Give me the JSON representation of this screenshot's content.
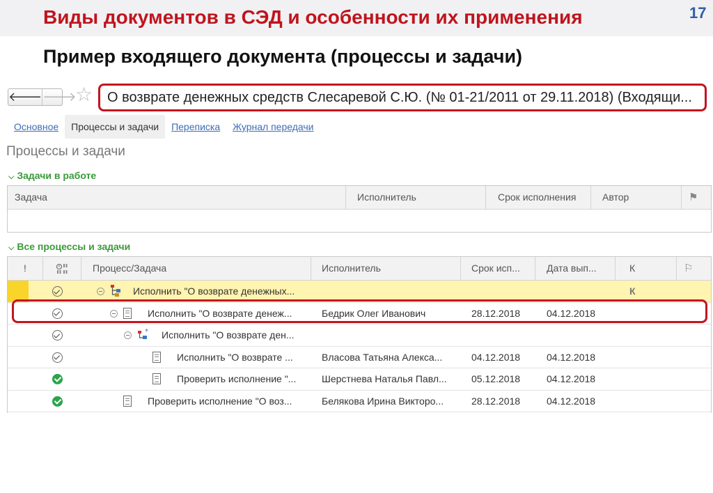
{
  "slide": {
    "title": "Виды документов в СЭД и особенности их применения",
    "page_number": "17",
    "subtitle": "Пример входящего документа (процессы и задачи)"
  },
  "toolbar": {
    "back_glyph": "🡐",
    "forward_glyph": "🡒",
    "star_glyph": "☆",
    "document_title": "О возврате денежных средств Слесаревой С.Ю. (№ 01-21/2011 от 29.11.2018) (Входящи..."
  },
  "tabs": [
    {
      "label": "Основное",
      "active": false
    },
    {
      "label": "Процессы и задачи",
      "active": true
    },
    {
      "label": "Переписка",
      "active": false
    },
    {
      "label": "Журнал передачи",
      "active": false
    }
  ],
  "section_title": "Процессы и задачи",
  "tasks_in_work": {
    "header": "Задачи в работе",
    "columns": [
      "Задача",
      "Исполнитель",
      "Срок исполнения",
      "Автор"
    ]
  },
  "all_processes": {
    "header": "Все процессы и задачи",
    "columns": [
      "!",
      "Процесс/Задача",
      "Исполнитель",
      "Срок исп...",
      "Дата вып...",
      "К"
    ],
    "rows": [
      {
        "task": "Исполнить \"О возврате денежных...",
        "executor": "",
        "due": "",
        "done": "",
        "k": "К",
        "check": "outline",
        "icon": "process",
        "highlight": true
      },
      {
        "task": "Исполнить \"О возврате денеж...",
        "executor": "Бедрик Олег Иванович",
        "due": "28.12.2018",
        "done": "04.12.2018",
        "k": "",
        "check": "outline",
        "icon": "doc",
        "highlight": false
      },
      {
        "task": "Исполнить \"О возврате ден...",
        "executor": "",
        "due": "",
        "done": "",
        "k": "",
        "check": "outline",
        "icon": "process-star",
        "highlight": false
      },
      {
        "task": "Исполнить \"О возврате ...",
        "executor": "Власова Татьяна Алекса...",
        "due": "04.12.2018",
        "done": "04.12.2018",
        "k": "",
        "check": "outline",
        "icon": "doc",
        "highlight": false
      },
      {
        "task": "Проверить исполнение \"...",
        "executor": "Шерстнева Наталья Павл...",
        "due": "05.12.2018",
        "done": "04.12.2018",
        "k": "",
        "check": "filled",
        "icon": "doc",
        "highlight": false
      },
      {
        "task": "Проверить исполнение \"О воз...",
        "executor": "Белякова Ирина Викторо...",
        "due": "28.12.2018",
        "done": "04.12.2018",
        "k": "",
        "check": "filled",
        "icon": "doc",
        "highlight": false
      }
    ]
  },
  "colors": {
    "title_red": "#c0141d",
    "page_blue": "#2f5fa8",
    "outline_red": "#c4141f",
    "group_green": "#3a9a3a",
    "row_highlight": "#fff4b0",
    "status_yellow": "#f9d52c",
    "check_green": "#2ba44a"
  },
  "icons": [
    "arrow-left-icon",
    "arrow-right-icon",
    "star-icon",
    "clock-icon",
    "flag-icon",
    "checkmark-icon",
    "collapse-icon",
    "document-icon",
    "process-icon"
  ]
}
